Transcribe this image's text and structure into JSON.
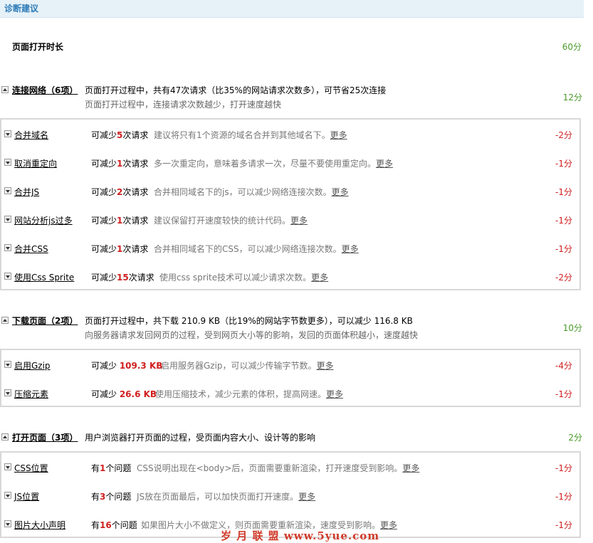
{
  "header": {
    "title": "诊断建议"
  },
  "load_time": {
    "label": "页面打开时长",
    "score": "60分"
  },
  "sections": [
    {
      "name": "连接网络（6项）",
      "summary": "页面打开过程中，共有47次请求（比35%的网站请求次数多），可节省25次连接",
      "desc": "页面打开过程中，连接请求次数越少，打开速度越快",
      "score": "12分",
      "items": [
        {
          "name": "合并域名",
          "prefix": "可减少",
          "value": "5",
          "suffix": "次请求",
          "desc": "建议将只有1个资源的域名合并到其他域名下。",
          "more": "更多",
          "score": "-2分"
        },
        {
          "name": "取消重定向",
          "prefix": "可减少",
          "value": "1",
          "suffix": "次请求",
          "desc": "多一次重定向，意味着多请求一次，尽量不要使用重定向。",
          "more": "更多",
          "score": "-1分"
        },
        {
          "name": "合并JS",
          "prefix": "可减少",
          "value": "2",
          "suffix": "次请求",
          "desc": "合并相同域名下的js，可以减少网络连接次数。",
          "more": "更多",
          "score": "-1分"
        },
        {
          "name": "网站分析js过多",
          "prefix": "可减少",
          "value": "1",
          "suffix": "次请求",
          "desc": "建议保留打开速度较快的统计代码。",
          "more": "更多",
          "score": "-1分"
        },
        {
          "name": "合并CSS",
          "prefix": "可减少",
          "value": "1",
          "suffix": "次请求",
          "desc": "合并相同域名下的CSS，可以减少网络连接次数。",
          "more": "更多",
          "score": "-1分"
        },
        {
          "name": "使用Css Sprite",
          "prefix": "可减少",
          "value": "15",
          "suffix": "次请求",
          "desc": "使用css sprite技术可以减少请求次数。",
          "more": "更多",
          "score": "-2分"
        }
      ]
    },
    {
      "name": "下载页面（2项）",
      "summary": "页面打开过程中，共下载 210.9 KB（比19%的网站字节数更多），可以减少 116.8 KB",
      "desc": "向服务器请求发回网页的过程，受到网页大小等的影响，发回的页面体积越小，速度越快",
      "score": "10分",
      "items": [
        {
          "name": "启用Gzip",
          "prefix": "可减少 ",
          "value": "109.3 KB",
          "suffix": "",
          "desc": "启用服务器Gzip，可以减少传输字节数。",
          "more": "更多",
          "score": "-4分"
        },
        {
          "name": "压缩元素",
          "prefix": "可减少 ",
          "value": "26.6 KB",
          "suffix": "",
          "desc": "使用压缩技术，减少元素的体积，提高网速。",
          "more": "更多",
          "score": "-1分"
        }
      ]
    },
    {
      "name": "打开页面（3项）",
      "summary": "用户浏览器打开页面的过程，受页面内容大小、设计等的影响",
      "desc": "",
      "score": "2分",
      "items": [
        {
          "name": "CSS位置",
          "prefix": "有",
          "value": "1",
          "suffix": "个问题",
          "desc": "CSS说明出现在<body>后，页面需要重新渲染，打开速度受到影响。",
          "more": "更多",
          "score": "-1分"
        },
        {
          "name": "JS位置",
          "prefix": "有",
          "value": "3",
          "suffix": "个问题",
          "desc": "JS放在页面最后，可以加快页面打开速度。",
          "more": "更多",
          "score": "-1分"
        },
        {
          "name": "图片大小声明",
          "prefix": "有",
          "value": "16",
          "suffix": "个问题",
          "desc": "如果图片大小不做定义，则页面需要重新渲染，速度受到影响。",
          "more": "更多",
          "score": "-1分"
        }
      ]
    }
  ],
  "watermark": "岁 月 联 盟   www.5yue.com",
  "colors": {
    "score_positive": "#4a9a29",
    "score_negative": "#d01e1e",
    "header_bg": "#e6f1f8",
    "header_text": "#2a7ab8"
  }
}
